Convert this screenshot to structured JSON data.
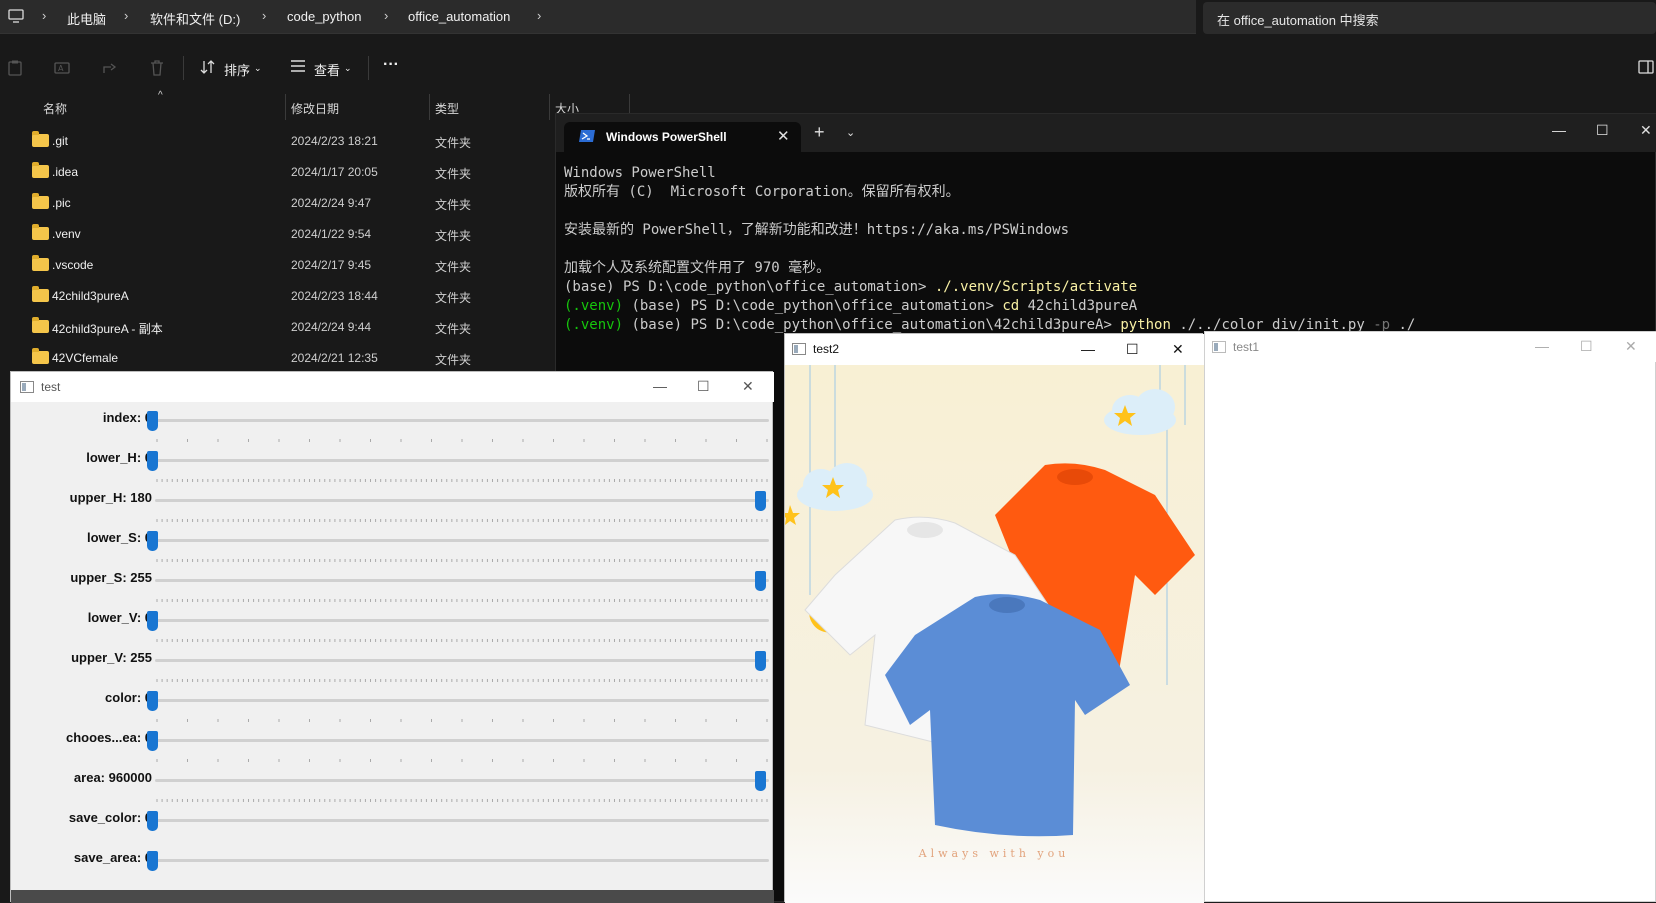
{
  "explorer": {
    "breadcrumb": [
      "此电脑",
      "软件和文件 (D:)",
      "code_python",
      "office_automation"
    ],
    "search_placeholder": "在 office_automation 中搜索",
    "toolbar": {
      "sort_label": "排序",
      "view_label": "查看",
      "more_label": "···"
    },
    "columns": {
      "name": "名称",
      "date": "修改日期",
      "type": "类型",
      "size": "大小"
    },
    "files": [
      {
        "name": ".git",
        "date": "2024/2/23 18:21",
        "type": "文件夹"
      },
      {
        "name": ".idea",
        "date": "2024/1/17 20:05",
        "type": "文件夹"
      },
      {
        "name": ".pic",
        "date": "2024/2/24 9:47",
        "type": "文件夹"
      },
      {
        "name": ".venv",
        "date": "2024/1/22 9:54",
        "type": "文件夹"
      },
      {
        "name": ".vscode",
        "date": "2024/2/17 9:45",
        "type": "文件夹"
      },
      {
        "name": "42child3pureA",
        "date": "2024/2/23 18:44",
        "type": "文件夹"
      },
      {
        "name": "42child3pureA - 副本",
        "date": "2024/2/24 9:44",
        "type": "文件夹"
      },
      {
        "name": "42VCfemale",
        "date": "2024/2/21 12:35",
        "type": "文件夹"
      }
    ]
  },
  "powershell": {
    "tab_title": "Windows PowerShell",
    "lines": [
      "Windows PowerShell",
      "版权所有 (C)  Microsoft Corporation。保留所有权利。",
      "",
      "安装最新的 PowerShell，了解新功能和改进！https://aka.ms/PSWindows",
      "",
      "加载个人及系统配置文件用了 970 毫秒。"
    ],
    "prompt1": "(base) PS D:\\code_python\\office_automation> ",
    "cmd1": "./.venv/Scripts/activate",
    "venv": "(.venv)",
    "prompt2": " (base) PS D:\\code_python\\office_automation> ",
    "cmd2a": "cd",
    "cmd2b": " 42child3pureA",
    "prompt3": " (base) PS D:\\code_python\\office_automation\\42child3pureA> ",
    "cmd3a": "python",
    "cmd3b": " ./../color_div/init.py ",
    "cmd3c": "-p",
    "cmd3d": " ./"
  },
  "test_window": {
    "title": "test",
    "trackbars": [
      {
        "label": "index: 0",
        "value": 0,
        "max": 100
      },
      {
        "label": "lower_H: 0",
        "value": 0,
        "max": 180
      },
      {
        "label": "upper_H: 180",
        "value": 180,
        "max": 180
      },
      {
        "label": "lower_S: 0",
        "value": 0,
        "max": 255
      },
      {
        "label": "upper_S: 255",
        "value": 255,
        "max": 255
      },
      {
        "label": "lower_V: 0",
        "value": 0,
        "max": 255
      },
      {
        "label": "upper_V: 255",
        "value": 255,
        "max": 255
      },
      {
        "label": "color: 0",
        "value": 0,
        "max": 100
      },
      {
        "label": "chooes...ea: 0",
        "value": 0,
        "max": 100
      },
      {
        "label": "area: 960000",
        "value": 960000,
        "max": 960000
      },
      {
        "label": "save_color: 0",
        "value": 0,
        "max": 1
      },
      {
        "label": "save_area: 0",
        "value": 0,
        "max": 1
      }
    ]
  },
  "test2_window": {
    "title": "test2",
    "image_caption": "Always with you"
  },
  "test1_window": {
    "title": "test1"
  },
  "colors": {
    "accent": "#1976d2",
    "tshirt_orange": "#ff5a10",
    "tshirt_blue": "#5b8dd6",
    "tshirt_white": "#f7f7f7",
    "bg_cream": "#f7f0d8"
  }
}
